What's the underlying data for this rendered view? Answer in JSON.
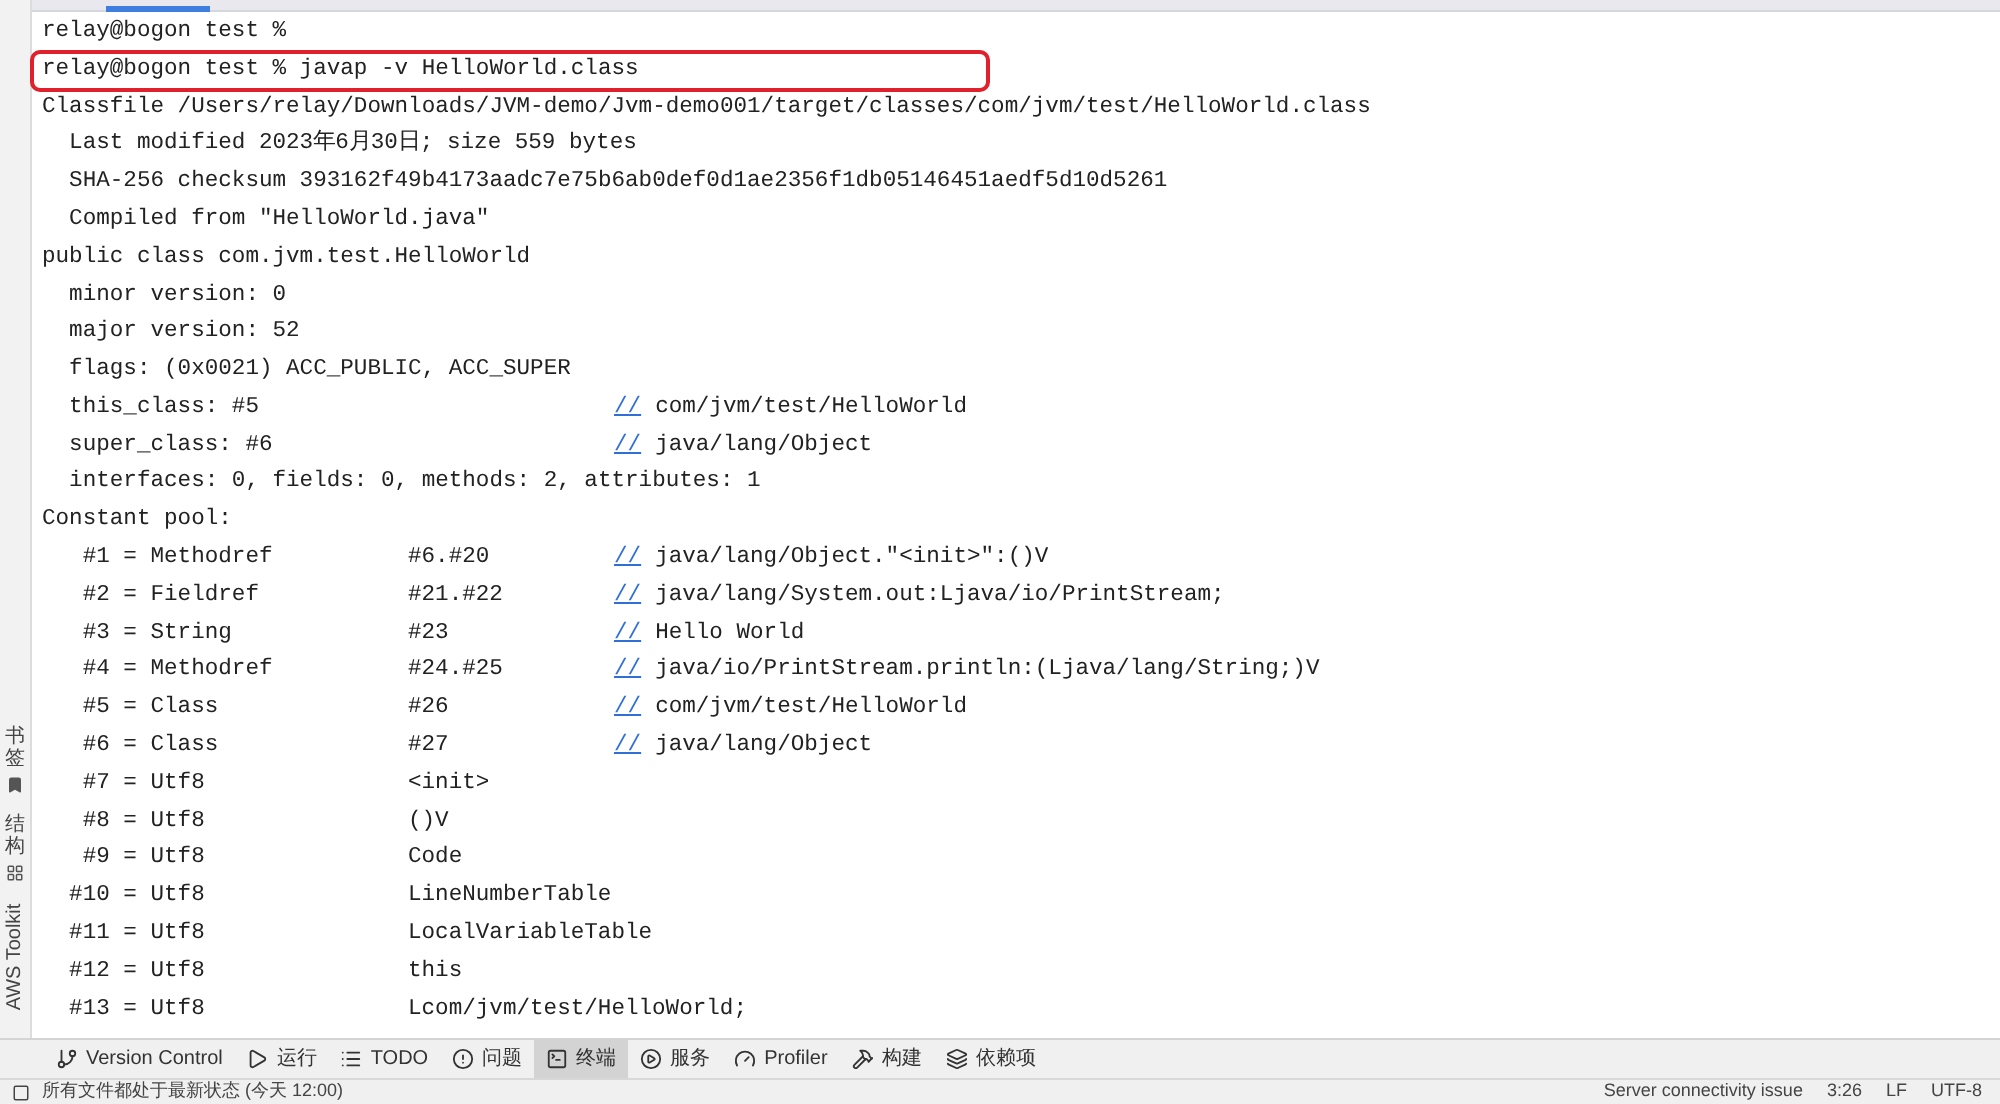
{
  "side_panel": [
    {
      "label": "书签",
      "kind": "cjk"
    },
    {
      "label": "结构",
      "kind": "cjk"
    },
    {
      "label": "AWS Toolkit",
      "kind": "latin"
    }
  ],
  "terminal": {
    "lines": [
      {
        "kind": "text",
        "text": "relay@bogon test %",
        "boxed": false
      },
      {
        "kind": "text",
        "text": "relay@bogon test % javap -v HelloWorld.class",
        "boxed": true
      },
      {
        "kind": "text",
        "text": "Classfile /Users/relay/Downloads/JVM-demo/Jvm-demo001/target/classes/com/jvm/test/HelloWorld.class",
        "boxed": false
      },
      {
        "kind": "text",
        "text": "  Last modified 2023年6月30日; size 559 bytes",
        "boxed": false
      },
      {
        "kind": "text",
        "text": "  SHA-256 checksum 393162f49b4173aadc7e75b6ab0def0d1ae2356f1db05146451aedf5d10d5261",
        "boxed": false
      },
      {
        "kind": "text",
        "text": "  Compiled from \"HelloWorld.java\"",
        "boxed": false
      },
      {
        "kind": "text",
        "text": "public class com.jvm.test.HelloWorld",
        "boxed": false
      },
      {
        "kind": "text",
        "text": "  minor version: 0",
        "boxed": false
      },
      {
        "kind": "text",
        "text": "  major version: 52",
        "boxed": false
      },
      {
        "kind": "text",
        "text": "  flags: (0x0021) ACC_PUBLIC, ACC_SUPER",
        "boxed": false
      },
      {
        "kind": "entry",
        "text": "  this_class: #5",
        "comment": "com/jvm/test/HelloWorld",
        "boxed": false
      },
      {
        "kind": "entry",
        "text": "  super_class: #6",
        "comment": "java/lang/Object",
        "boxed": false
      },
      {
        "kind": "text",
        "text": "  interfaces: 0, fields: 0, methods: 2, attributes: 1",
        "boxed": false
      },
      {
        "kind": "text",
        "text": "Constant pool:",
        "boxed": false
      },
      {
        "kind": "pool",
        "text": "   #1 = Methodref",
        "ref": "#6.#20",
        "comment": "java/lang/Object.\"<init>\":()V",
        "boxed": false
      },
      {
        "kind": "pool",
        "text": "   #2 = Fieldref",
        "ref": "#21.#22",
        "comment": "java/lang/System.out:Ljava/io/PrintStream;",
        "boxed": false
      },
      {
        "kind": "pool",
        "text": "   #3 = String",
        "ref": "#23",
        "comment": "Hello World",
        "boxed": false
      },
      {
        "kind": "pool",
        "text": "   #4 = Methodref",
        "ref": "#24.#25",
        "comment": "java/io/PrintStream.println:(Ljava/lang/String;)V",
        "boxed": false
      },
      {
        "kind": "pool",
        "text": "   #5 = Class",
        "ref": "#26",
        "comment": "com/jvm/test/HelloWorld",
        "boxed": false
      },
      {
        "kind": "pool",
        "text": "   #6 = Class",
        "ref": "#27",
        "comment": "java/lang/Object",
        "boxed": false
      },
      {
        "kind": "pool",
        "text": "   #7 = Utf8",
        "ref": "<init>",
        "boxed": false
      },
      {
        "kind": "pool",
        "text": "   #8 = Utf8",
        "ref": "()V",
        "boxed": false
      },
      {
        "kind": "pool",
        "text": "   #9 = Utf8",
        "ref": "Code",
        "boxed": false
      },
      {
        "kind": "pool",
        "text": "  #10 = Utf8",
        "ref": "LineNumberTable",
        "boxed": false
      },
      {
        "kind": "pool",
        "text": "  #11 = Utf8",
        "ref": "LocalVariableTable",
        "boxed": false
      },
      {
        "kind": "pool",
        "text": "  #12 = Utf8",
        "ref": "this",
        "boxed": false
      },
      {
        "kind": "pool",
        "text": "  #13 = Utf8",
        "ref": "Lcom/jvm/test/HelloWorld;",
        "boxed": false
      }
    ],
    "comment_mark": "//"
  },
  "tool_tabs": [
    {
      "label": "Version Control",
      "selected": false
    },
    {
      "label": "运行",
      "selected": false
    },
    {
      "label": "TODO",
      "selected": false
    },
    {
      "label": "问题",
      "selected": false
    },
    {
      "label": "终端",
      "selected": true
    },
    {
      "label": "服务",
      "selected": false
    },
    {
      "label": "Profiler",
      "selected": false
    },
    {
      "label": "构建",
      "selected": false
    },
    {
      "label": "依赖项",
      "selected": false
    }
  ],
  "status_bar": {
    "message": "所有文件都处于最新状态 (今天 12:00)",
    "right": [
      "Server connectivity issue",
      "3:26",
      "LF",
      "UTF-8"
    ]
  }
}
